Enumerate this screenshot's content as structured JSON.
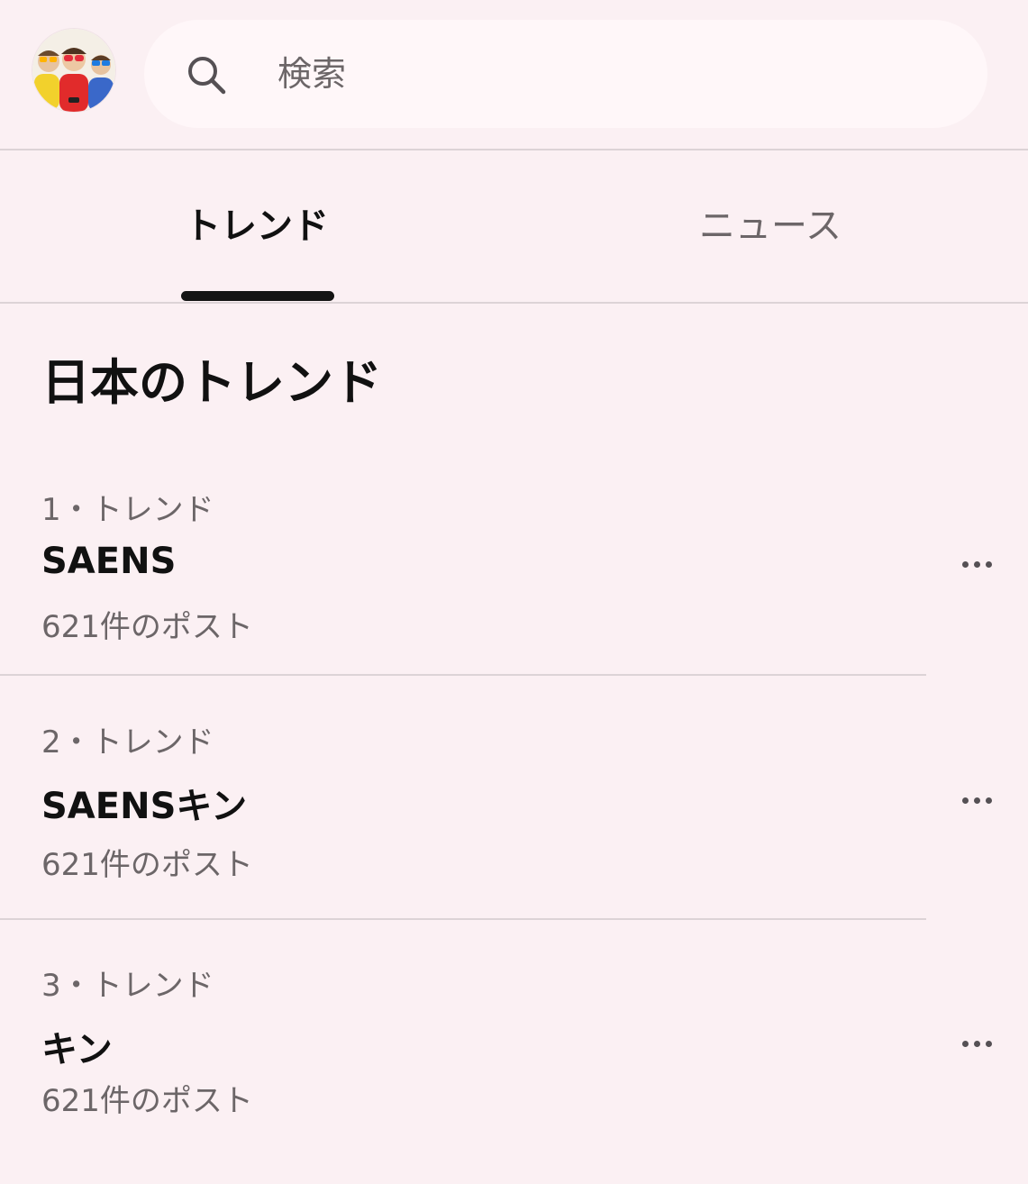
{
  "header": {
    "avatar": "profile-avatar",
    "search": {
      "placeholder": "検索",
      "value": ""
    }
  },
  "tabs": [
    {
      "label": "トレンド",
      "active": true
    },
    {
      "label": "ニュース",
      "active": false
    }
  ],
  "section": {
    "title": "日本のトレンド"
  },
  "trends": [
    {
      "meta": "1・トレンド",
      "name": "SAENS",
      "count": "621件のポスト"
    },
    {
      "meta": "2・トレンド",
      "name": "SAENSキン",
      "count": "621件のポスト"
    },
    {
      "meta": "3・トレンド",
      "name": "キン",
      "count": "621件のポスト"
    }
  ],
  "colors": {
    "background": "#fbf0f3",
    "search_background": "#fff7f9",
    "primary_text": "#111111",
    "secondary_text": "#6c6668",
    "divider": "#dcd3d6",
    "tab_indicator": "#141414"
  }
}
